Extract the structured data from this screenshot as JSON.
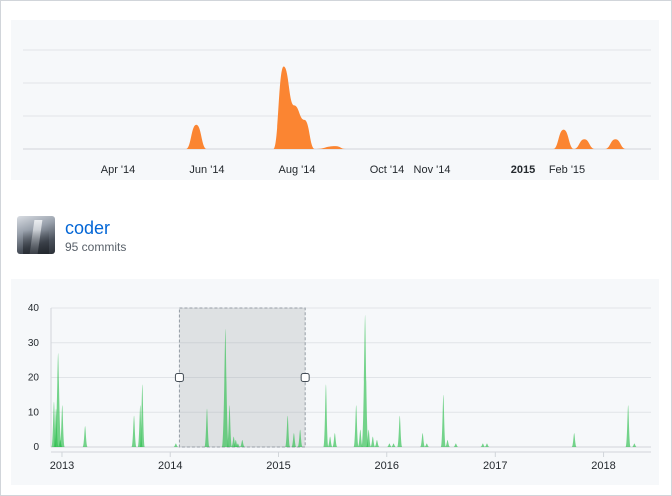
{
  "overview_chart": {
    "accent_color": "#fb8532",
    "x_ticks": [
      {
        "label": "Apr '14",
        "bold": false
      },
      {
        "label": "Jun '14",
        "bold": false
      },
      {
        "label": "Aug '14",
        "bold": false
      },
      {
        "label": "Oct '14",
        "bold": false
      },
      {
        "label": "Nov '14",
        "bold": false
      },
      {
        "label": "2015",
        "bold": true
      },
      {
        "label": "Feb '15",
        "bold": false
      }
    ]
  },
  "contributor": {
    "name": "coder",
    "commits_label": "95 commits"
  },
  "chart_data": [
    {
      "type": "area",
      "series": [
        {
          "color": "#fb8532",
          "x": [
            "2014-05-22",
            "2014-05-29",
            "2014-06-05",
            "2014-07-20",
            "2014-07-27",
            "2014-08-03",
            "2014-08-10",
            "2014-08-17",
            "2014-08-31",
            "2014-09-07",
            "2015-01-25",
            "2015-02-01",
            "2015-02-08",
            "2015-02-15",
            "2015-02-22",
            "2015-03-01",
            "2015-03-08",
            "2015-03-15"
          ],
          "y": [
            0,
            5,
            0,
            0,
            17,
            9,
            6,
            0,
            0.6,
            0,
            0,
            4,
            0,
            2,
            0,
            0,
            2,
            0
          ]
        }
      ],
      "xlim": [
        "2014-02-01",
        "2015-04-01"
      ],
      "ylim": [
        0,
        20
      ],
      "x_tick_labels": [
        "Apr '14",
        "Jun '14",
        "Aug '14",
        "Oct '14",
        "Nov '14",
        "2015",
        "Feb '15"
      ],
      "grid": true
    },
    {
      "type": "area",
      "series": [
        {
          "color": "#2cbe4e",
          "x": [
            "2012-12-05",
            "2012-12-12",
            "2012-12-19",
            "2012-12-26",
            "2013-01-02",
            "2013-01-16",
            "2013-03-20",
            "2013-09-01",
            "2013-09-22",
            "2013-09-29",
            "2013-10-06",
            "2014-01-20",
            "2014-05-05",
            "2014-07-06",
            "2014-07-20",
            "2014-08-03",
            "2014-08-10",
            "2014-08-17",
            "2014-09-01",
            "2015-02-01",
            "2015-02-22",
            "2015-03-15",
            "2015-06-10",
            "2015-06-24",
            "2015-07-10",
            "2015-09-20",
            "2015-10-04",
            "2015-10-20",
            "2015-11-01",
            "2015-11-15",
            "2015-11-29",
            "2016-01-10",
            "2016-01-24",
            "2016-02-14",
            "2016-05-01",
            "2016-05-15",
            "2016-07-10",
            "2016-07-24",
            "2016-08-21",
            "2016-11-20",
            "2016-12-04",
            "2017-09-24",
            "2018-03-25",
            "2018-04-15"
          ],
          "y": [
            13,
            11,
            27,
            2,
            12,
            0,
            6,
            9,
            12,
            18,
            0,
            1,
            11,
            34,
            12,
            3,
            2,
            1,
            2,
            9,
            4,
            5,
            18,
            3,
            4,
            12,
            5,
            38,
            5,
            3,
            2,
            1,
            1,
            9,
            4,
            1,
            15,
            2,
            1,
            1,
            1,
            4,
            12,
            1
          ]
        }
      ],
      "xlim": [
        "2012-11-25",
        "2018-06-10"
      ],
      "ylim": [
        0,
        40
      ],
      "y_ticks": [
        0,
        10,
        20,
        30,
        40
      ],
      "x_tick_labels": [
        "2013",
        "2014",
        "2015",
        "2016",
        "2017",
        "2018"
      ],
      "selection": [
        "2014-02-01",
        "2015-04-01"
      ],
      "grid": true
    }
  ]
}
